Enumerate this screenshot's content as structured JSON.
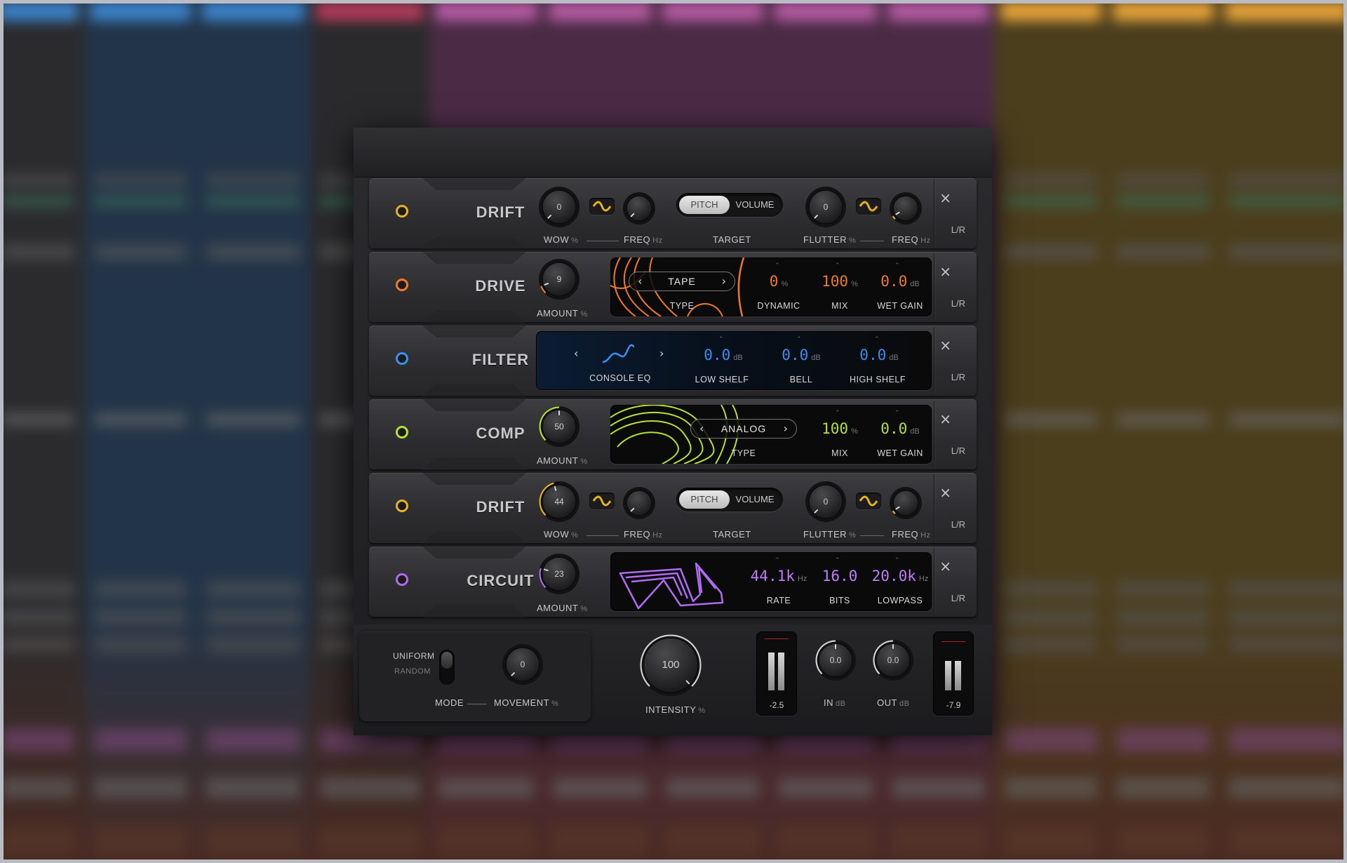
{
  "colors": {
    "drift": "#e9b21f",
    "drive": "#f07a2a",
    "filter": "#3d8ff0",
    "comp": "#b5e234",
    "circuit": "#b06bf2"
  },
  "modules": [
    {
      "name": "DRIFT",
      "wow": {
        "value": "0",
        "label": "WOW",
        "unit": "%"
      },
      "wow_freq": {
        "label": "FREQ",
        "unit": "Hz"
      },
      "target": {
        "label": "TARGET",
        "options": [
          "PITCH",
          "VOLUME"
        ],
        "selected": "PITCH"
      },
      "flutter": {
        "value": "0",
        "label": "FLUTTER",
        "unit": "%"
      },
      "flutter_freq": {
        "label": "FREQ",
        "unit": "Hz"
      },
      "close": "×",
      "channel": "L/R"
    },
    {
      "name": "DRIVE",
      "amount": {
        "value": "9",
        "label": "AMOUNT",
        "unit": "%"
      },
      "type": {
        "value": "TAPE",
        "label": "TYPE"
      },
      "dynamic": {
        "value": "0",
        "unit": "%",
        "label": "DYNAMIC"
      },
      "mix": {
        "value": "100",
        "unit": "%",
        "label": "MIX"
      },
      "wet_gain": {
        "value": "0.0",
        "unit": "dB",
        "label": "WET GAIN"
      },
      "close": "×",
      "channel": "L/R"
    },
    {
      "name": "FILTER",
      "type": {
        "value": "CONSOLE EQ"
      },
      "low_shelf": {
        "value": "0.0",
        "unit": "dB",
        "label": "LOW SHELF"
      },
      "bell": {
        "value": "0.0",
        "unit": "dB",
        "label": "BELL"
      },
      "high_shelf": {
        "value": "0.0",
        "unit": "dB",
        "label": "HIGH SHELF"
      },
      "close": "×",
      "channel": "L/R"
    },
    {
      "name": "COMP",
      "amount": {
        "value": "50",
        "label": "AMOUNT",
        "unit": "%"
      },
      "type": {
        "value": "ANALOG",
        "label": "TYPE"
      },
      "mix": {
        "value": "100",
        "unit": "%",
        "label": "MIX"
      },
      "wet_gain": {
        "value": "0.0",
        "unit": "dB",
        "label": "WET GAIN"
      },
      "close": "×",
      "channel": "L/R"
    },
    {
      "name": "DRIFT",
      "wow": {
        "value": "44",
        "label": "WOW",
        "unit": "%"
      },
      "wow_freq": {
        "label": "FREQ",
        "unit": "Hz"
      },
      "target": {
        "label": "TARGET",
        "options": [
          "PITCH",
          "VOLUME"
        ],
        "selected": "PITCH"
      },
      "flutter": {
        "value": "0",
        "label": "FLUTTER",
        "unit": "%"
      },
      "flutter_freq": {
        "label": "FREQ",
        "unit": "Hz"
      },
      "close": "×",
      "channel": "L/R"
    },
    {
      "name": "CIRCUIT",
      "amount": {
        "value": "23",
        "label": "AMOUNT",
        "unit": "%"
      },
      "rate": {
        "value": "44.1k",
        "unit": "Hz",
        "label": "RATE"
      },
      "bits": {
        "value": "16.0",
        "label": "BITS"
      },
      "lowpass": {
        "value": "20.0k",
        "unit": "Hz",
        "label": "LOWPASS"
      },
      "close": "×",
      "channel": "L/R"
    }
  ],
  "footer": {
    "mode": {
      "options": [
        "UNIFORM",
        "RANDOM"
      ],
      "selected": "UNIFORM",
      "label": "MODE"
    },
    "movement": {
      "value": "0",
      "label": "MOVEMENT",
      "unit": "%"
    },
    "intensity": {
      "value": "100",
      "label": "INTENSITY",
      "unit": "%"
    },
    "in_meter": {
      "value": "-2.5"
    },
    "in_gain": {
      "value": "0.0",
      "label": "IN",
      "unit": "dB"
    },
    "out_gain": {
      "value": "0.0",
      "label": "OUT",
      "unit": "dB"
    },
    "out_meter": {
      "value": "-7.9"
    }
  }
}
